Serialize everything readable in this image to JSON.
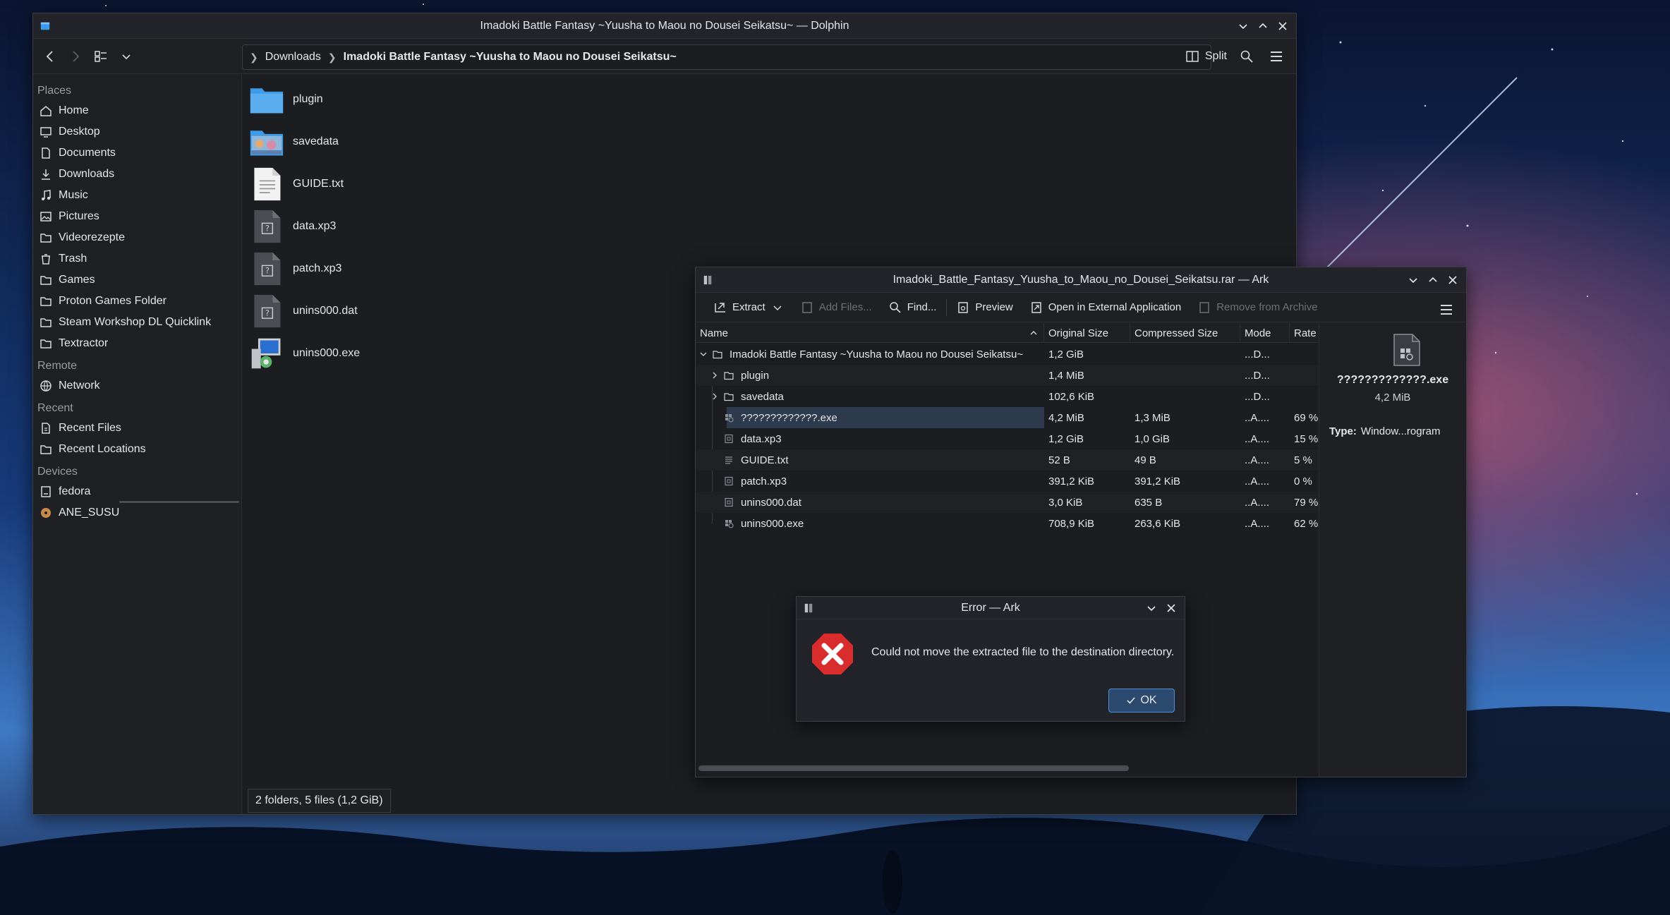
{
  "colors": {
    "accent": "#3d9ae8",
    "error_red": "#d92d2d",
    "folder_blue": "#3d9ae8"
  },
  "dolphin": {
    "title": "Imadoki Battle Fantasy ~Yuusha to Maou no Dousei Seikatsu~ — Dolphin",
    "breadcrumb": {
      "parent": "Downloads",
      "current": "Imadoki Battle Fantasy ~Yuusha to Maou no Dousei Seikatsu~"
    },
    "split_label": "Split",
    "sidebar": {
      "places_header": "Places",
      "places": [
        {
          "label": "Home",
          "icon": "home-icon"
        },
        {
          "label": "Desktop",
          "icon": "desktop-icon"
        },
        {
          "label": "Documents",
          "icon": "documents-icon"
        },
        {
          "label": "Downloads",
          "icon": "downloads-icon"
        },
        {
          "label": "Music",
          "icon": "music-icon"
        },
        {
          "label": "Pictures",
          "icon": "pictures-icon"
        },
        {
          "label": "Videorezepte",
          "icon": "folder-icon"
        },
        {
          "label": "Trash",
          "icon": "trash-icon"
        },
        {
          "label": "Games",
          "icon": "folder-icon"
        },
        {
          "label": "Proton Games Folder",
          "icon": "folder-icon"
        },
        {
          "label": "Steam Workshop DL Quicklink",
          "icon": "folder-icon"
        },
        {
          "label": "Textractor",
          "icon": "folder-icon"
        }
      ],
      "remote_header": "Remote",
      "remote": [
        {
          "label": "Network",
          "icon": "network-icon"
        }
      ],
      "recent_header": "Recent",
      "recent": [
        {
          "label": "Recent Files",
          "icon": "recent-files-icon"
        },
        {
          "label": "Recent Locations",
          "icon": "recent-locations-icon"
        }
      ],
      "devices_header": "Devices",
      "devices": [
        {
          "label": "fedora",
          "icon": "drive-icon"
        },
        {
          "label": "ANE_SUSU",
          "icon": "disc-icon"
        }
      ]
    },
    "files": [
      {
        "name": "plugin",
        "kind": "folder"
      },
      {
        "name": "savedata",
        "kind": "image-folder"
      },
      {
        "name": "GUIDE.txt",
        "kind": "text"
      },
      {
        "name": "data.xp3",
        "kind": "unknown"
      },
      {
        "name": "patch.xp3",
        "kind": "unknown"
      },
      {
        "name": "unins000.dat",
        "kind": "unknown"
      },
      {
        "name": "unins000.exe",
        "kind": "exe"
      }
    ],
    "status": "2 folders, 5 files (1,2 GiB)"
  },
  "ark": {
    "title": "Imadoki_Battle_Fantasy_Yuusha_to_Maou_no_Dousei_Seikatsu.rar — Ark",
    "toolbar": {
      "extract": "Extract",
      "add_files": "Add Files...",
      "find": "Find...",
      "preview": "Preview",
      "open_external": "Open in External Application",
      "remove": "Remove from Archive"
    },
    "columns": {
      "name": "Name",
      "original": "Original Size",
      "compressed": "Compressed Size",
      "mode": "Mode",
      "rate": "Rate"
    },
    "rows": [
      {
        "name": "Imadoki Battle Fantasy ~Yuusha to Maou no Dousei Seikatsu~",
        "orig": "1,2 GiB",
        "comp": "",
        "mode": "...D...",
        "rate": ""
      },
      {
        "name": "plugin",
        "orig": "1,4 MiB",
        "comp": "",
        "mode": "...D...",
        "rate": ""
      },
      {
        "name": "savedata",
        "orig": "102,6 KiB",
        "comp": "",
        "mode": "...D...",
        "rate": ""
      },
      {
        "name": "?????????????.exe",
        "orig": "4,2 MiB",
        "comp": "1,3 MiB",
        "mode": "..A....",
        "rate": "69 %"
      },
      {
        "name": "data.xp3",
        "orig": "1,2 GiB",
        "comp": "1,0 GiB",
        "mode": "..A....",
        "rate": "15 %"
      },
      {
        "name": "GUIDE.txt",
        "orig": "52 B",
        "comp": "49 B",
        "mode": "..A....",
        "rate": "5 %"
      },
      {
        "name": "patch.xp3",
        "orig": "391,2 KiB",
        "comp": "391,2 KiB",
        "mode": "..A....",
        "rate": "0 %"
      },
      {
        "name": "unins000.dat",
        "orig": "3,0 KiB",
        "comp": "635 B",
        "mode": "..A....",
        "rate": "79 %"
      },
      {
        "name": "unins000.exe",
        "orig": "708,9 KiB",
        "comp": "263,6 KiB",
        "mode": "..A....",
        "rate": "62 %"
      }
    ],
    "panel": {
      "name": "?????????????.exe",
      "size": "4,2 MiB",
      "type_label": "Type:",
      "type_value": "Window...rogram"
    }
  },
  "error": {
    "title": "Error — Ark",
    "message": "Could not move the extracted file to the destination directory.",
    "ok": "OK"
  }
}
